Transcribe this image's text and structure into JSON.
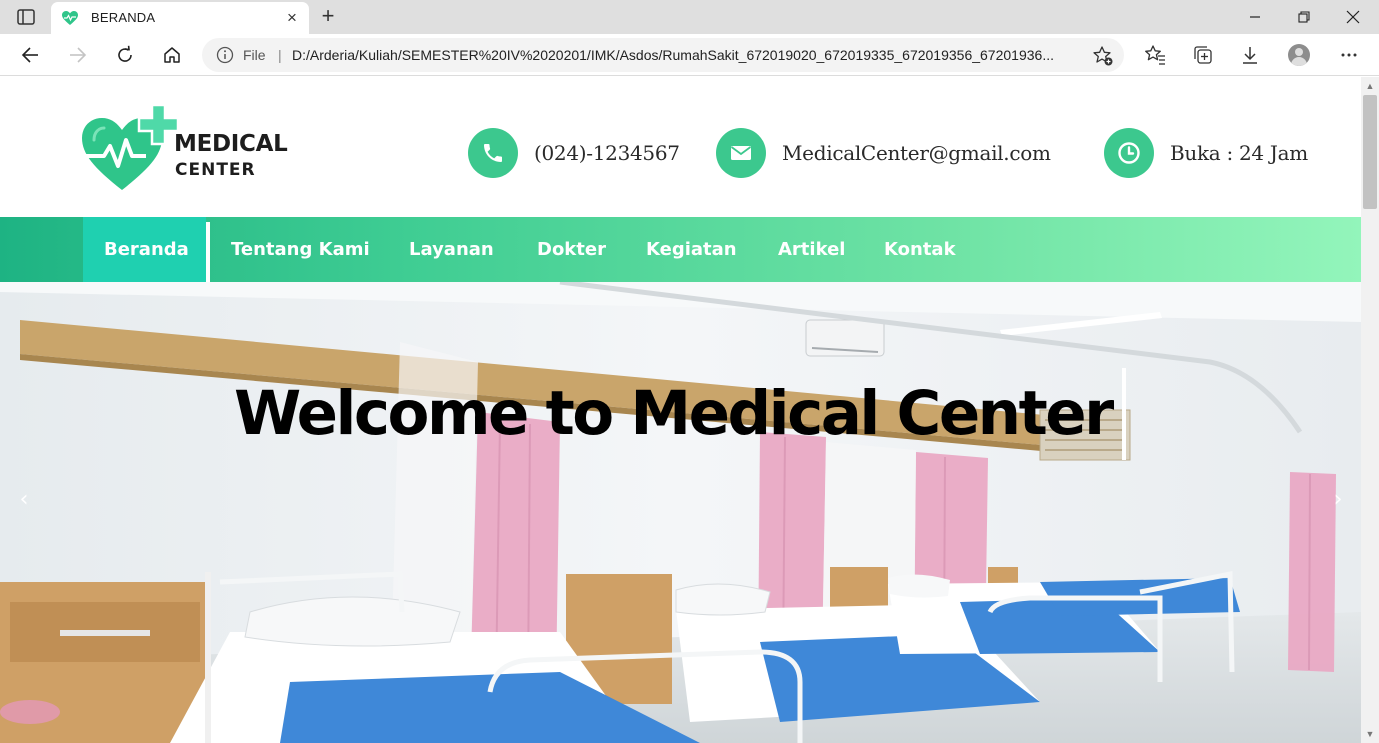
{
  "browser": {
    "tab_title": "BERANDA",
    "new_tab_symbol": "+",
    "close_tab_symbol": "×",
    "address_scheme_label": "File",
    "address_separator": "|",
    "url": "D:/Arderia/Kuliah/SEMESTER%20IV%2020201/IMK/Asdos/RumahSakit_672019020_672019335_672019356_67201936...",
    "icons": [
      "tab-actions-icon",
      "heart-favicon-icon",
      "minimize-icon",
      "restore-icon",
      "close-window-icon",
      "back-icon",
      "forward-icon",
      "refresh-icon",
      "home-icon",
      "info-icon",
      "add-favorite-icon",
      "favorites-icon",
      "collections-icon",
      "download-icon",
      "profile-icon",
      "more-icon"
    ]
  },
  "site": {
    "logo": {
      "line1": "MEDICAL",
      "line2": "CENTER",
      "colors": {
        "green": "#2fc58a",
        "cross": "#4fd9a8",
        "text": "#1d1d1d"
      }
    },
    "contacts": [
      {
        "icon": "phone-icon",
        "text": "(024)-1234567"
      },
      {
        "icon": "envelope-icon",
        "text": "MedicalCenter@gmail.com"
      },
      {
        "icon": "clock-icon",
        "text": "Buka : 24 Jam"
      }
    ],
    "menu": [
      {
        "label": "Beranda",
        "active": true
      },
      {
        "label": "Tentang Kami"
      },
      {
        "label": "Layanan"
      },
      {
        "label": "Dokter"
      },
      {
        "label": "Kegiatan"
      },
      {
        "label": "Artikel"
      },
      {
        "label": "Kontak"
      }
    ],
    "hero": {
      "title": "Welcome to Medical Center",
      "prev_symbol": "‹",
      "next_symbol": "›"
    },
    "colors": {
      "accent_green": "#3cc88e",
      "menu_gradient_start": "#1eb383",
      "menu_gradient_end": "#93f5bb",
      "menu_active": "#1fd0b0"
    }
  }
}
